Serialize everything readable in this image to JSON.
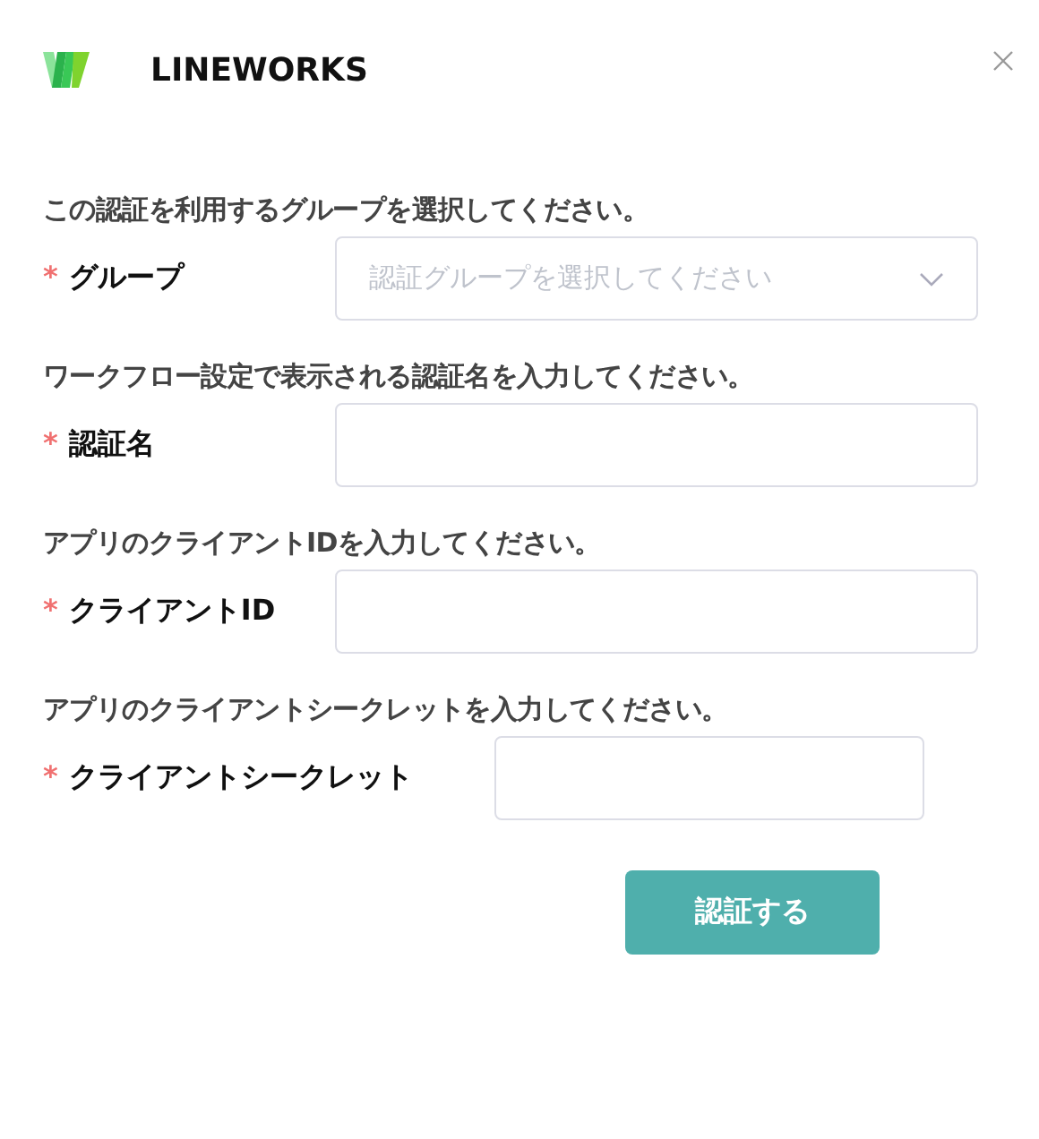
{
  "header": {
    "title": "LINEWORKS"
  },
  "fields": [
    {
      "kind": "select",
      "description": "この認証を利用するグループを選択してください。",
      "label": "グループ",
      "required": true,
      "placeholder": "認証グループを選択してください"
    },
    {
      "kind": "text",
      "description": "ワークフロー設定で表示される認証名を入力してください。",
      "label": "認証名",
      "required": true
    },
    {
      "kind": "text",
      "description": "アプリのクライアントIDを入力してください。",
      "label": "クライアントID",
      "required": true
    },
    {
      "kind": "text",
      "description": "アプリのクライアントシークレットを入力してください。",
      "label": "クライアントシークレット",
      "required": true
    }
  ],
  "submit": {
    "label": "認証する"
  },
  "required_mark": "*"
}
